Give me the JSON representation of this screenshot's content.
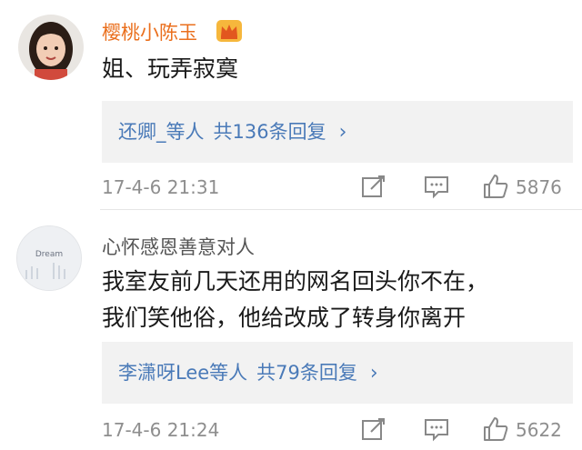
{
  "comments": [
    {
      "username": "樱桃小陈玉",
      "text_lines": [
        "姐、玩弄寂寞"
      ],
      "reply_names": "还卿_等人",
      "reply_count": "共136条回复",
      "timestamp": "17-4-6 21:31",
      "likes": "5876",
      "avatar_icon": "girl-avatar",
      "badge_icon": "crown-icon"
    },
    {
      "username": "心怀感恩善意对人",
      "text_lines": [
        "我室友前几天还用的网名回头你不在，",
        "我们笑他俗，他给改成了转身你离开"
      ],
      "reply_names": "李潇呀Lee等人",
      "reply_count": "共79条回复",
      "timestamp": "17-4-6 21:24",
      "likes": "5622",
      "avatar_icon": "dream-avatar",
      "avatar_text": "Dream"
    }
  ],
  "colors": {
    "username_vip": "#ea6f1d",
    "link": "#4a7ab8",
    "meta": "#8e8e8e",
    "reply_bg": "#f2f2f2"
  }
}
